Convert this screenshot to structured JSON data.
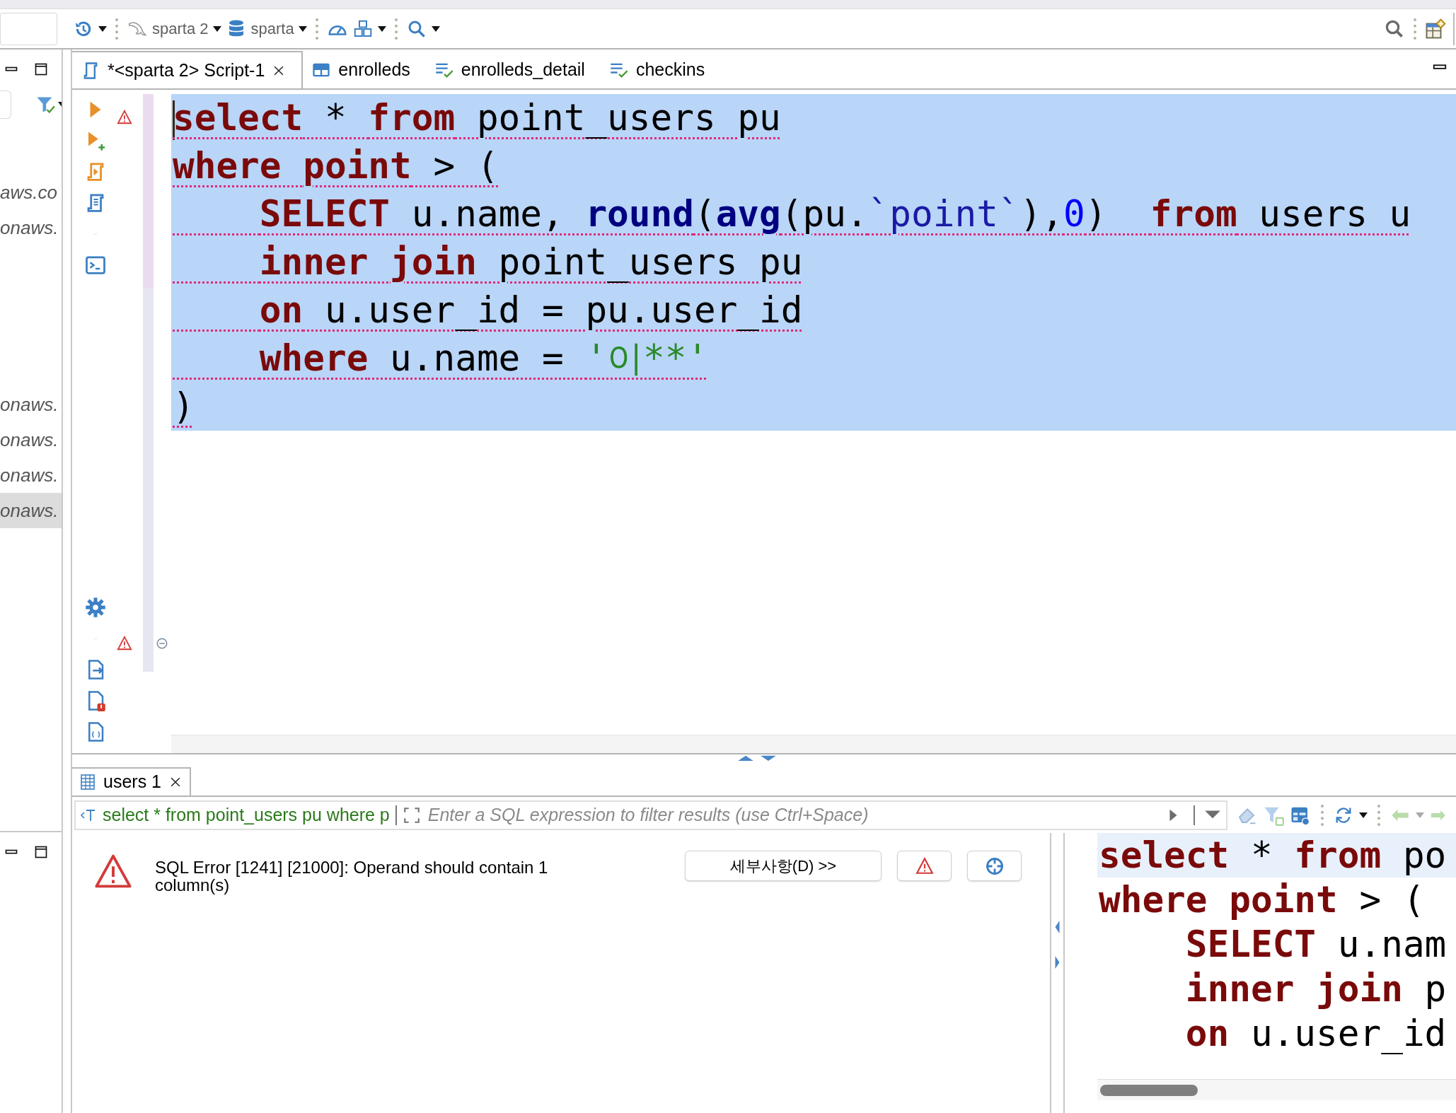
{
  "toolbar": {
    "left": [
      {
        "kind": "history",
        "dropdown": true
      },
      {
        "kind": "separator"
      },
      {
        "kind": "dolphin",
        "label": "sparta 2",
        "dropdown": true
      },
      {
        "kind": "database",
        "label": "sparta",
        "dropdown": true
      },
      {
        "kind": "separator"
      },
      {
        "kind": "gauge",
        "dropdown": false
      },
      {
        "kind": "boxes",
        "dropdown": true
      },
      {
        "kind": "separator"
      },
      {
        "kind": "search",
        "dropdown": true
      }
    ],
    "right": [
      {
        "kind": "search-gray",
        "dropdown": false
      },
      {
        "kind": "separator"
      },
      {
        "kind": "table-add",
        "dropdown": false
      }
    ]
  },
  "navigator": {
    "groups": [
      {
        "items": [
          {
            "label": "aws.co",
            "selected": false
          },
          {
            "label": "onaws.",
            "selected": false
          }
        ]
      },
      {
        "items": [
          {
            "label": "onaws.",
            "selected": false
          },
          {
            "label": "onaws.",
            "selected": false
          },
          {
            "label": "onaws.",
            "selected": false
          },
          {
            "label": "onaws.",
            "selected": true
          }
        ]
      }
    ]
  },
  "editor_tabs": [
    {
      "label": "*<sparta 2> Script-1",
      "kind": "script",
      "selected": true,
      "closable": true
    },
    {
      "label": "enrolleds",
      "kind": "table",
      "selected": false,
      "closable": false
    },
    {
      "label": "enrolleds_detail",
      "kind": "view",
      "selected": false,
      "closable": false
    },
    {
      "label": "checkins",
      "kind": "view",
      "selected": false,
      "closable": false
    }
  ],
  "editor": {
    "lines": [
      {
        "selected": true,
        "cursor": true,
        "indented": false,
        "tokens": [
          {
            "text": "select",
            "kind": "keyword"
          },
          {
            "text": " * ",
            "kind": "plain"
          },
          {
            "text": "from",
            "kind": "keyword"
          },
          {
            "text": " point_users pu",
            "kind": "plain"
          }
        ]
      },
      {
        "selected": true,
        "cursor": false,
        "indented": false,
        "tokens": [
          {
            "text": "where ",
            "kind": "keyword"
          },
          {
            "text": "point",
            "kind": "keyword"
          },
          {
            "text": " > (",
            "kind": "plain"
          }
        ]
      },
      {
        "selected": true,
        "cursor": false,
        "indented": true,
        "tokens": [
          {
            "text": "SELECT",
            "kind": "keyword"
          },
          {
            "text": " u.name, ",
            "kind": "plain"
          },
          {
            "text": "round",
            "kind": "function"
          },
          {
            "text": "(",
            "kind": "plain"
          },
          {
            "text": "avg",
            "kind": "function"
          },
          {
            "text": "(pu.",
            "kind": "plain"
          },
          {
            "text": "`point`",
            "kind": "identifier"
          },
          {
            "text": "),",
            "kind": "plain"
          },
          {
            "text": "0",
            "kind": "number"
          },
          {
            "text": ")  ",
            "kind": "plain"
          },
          {
            "text": "from",
            "kind": "keyword"
          },
          {
            "text": " users u",
            "kind": "plain"
          }
        ]
      },
      {
        "selected": true,
        "cursor": false,
        "indented": true,
        "tokens": [
          {
            "text": "inner ",
            "kind": "keyword"
          },
          {
            "text": "join",
            "kind": "keyword"
          },
          {
            "text": " point_users pu",
            "kind": "plain"
          }
        ]
      },
      {
        "selected": true,
        "cursor": false,
        "indented": true,
        "tokens": [
          {
            "text": "on",
            "kind": "keyword"
          },
          {
            "text": " u.user_id = pu.user_id",
            "kind": "plain"
          }
        ]
      },
      {
        "selected": true,
        "cursor": false,
        "indented": true,
        "tokens": [
          {
            "text": "where",
            "kind": "keyword"
          },
          {
            "text": " u.name = ",
            "kind": "plain"
          },
          {
            "text": "'이**'",
            "kind": "string"
          }
        ]
      },
      {
        "selected": true,
        "cursor": false,
        "indented": false,
        "tokens": [
          {
            "text": ")",
            "kind": "plain"
          }
        ]
      }
    ]
  },
  "results": {
    "tabs": [
      {
        "label": "users 1",
        "selected": true
      }
    ],
    "query": "select * from point_users pu where p",
    "filter_placeholder": "Enter a SQL expression to filter results (use Ctrl+Space)",
    "error": {
      "message": "SQL Error [1241] [21000]: Operand should contain 1 column(s)",
      "details_button": "세부사항(D) >>"
    },
    "query_panel": {
      "lines": [
        {
          "highlighted": true,
          "indented": false,
          "tokens": [
            {
              "text": "select",
              "kind": "keyword"
            },
            {
              "text": " * ",
              "kind": "plain"
            },
            {
              "text": "from",
              "kind": "keyword"
            },
            {
              "text": " po",
              "kind": "plain"
            }
          ]
        },
        {
          "highlighted": false,
          "indented": false,
          "tokens": [
            {
              "text": "where ",
              "kind": "keyword"
            },
            {
              "text": "point",
              "kind": "keyword"
            },
            {
              "text": " > (",
              "kind": "plain"
            }
          ]
        },
        {
          "highlighted": false,
          "indented": true,
          "tokens": [
            {
              "text": "SELECT",
              "kind": "keyword"
            },
            {
              "text": " u.nam",
              "kind": "plain"
            }
          ]
        },
        {
          "highlighted": false,
          "indented": true,
          "tokens": [
            {
              "text": "inner ",
              "kind": "keyword"
            },
            {
              "text": "join",
              "kind": "keyword"
            },
            {
              "text": " p",
              "kind": "plain"
            }
          ]
        },
        {
          "highlighted": false,
          "indented": true,
          "tokens": [
            {
              "text": "on",
              "kind": "keyword"
            },
            {
              "text": " u.user_id",
              "kind": "plain"
            }
          ]
        }
      ]
    }
  }
}
